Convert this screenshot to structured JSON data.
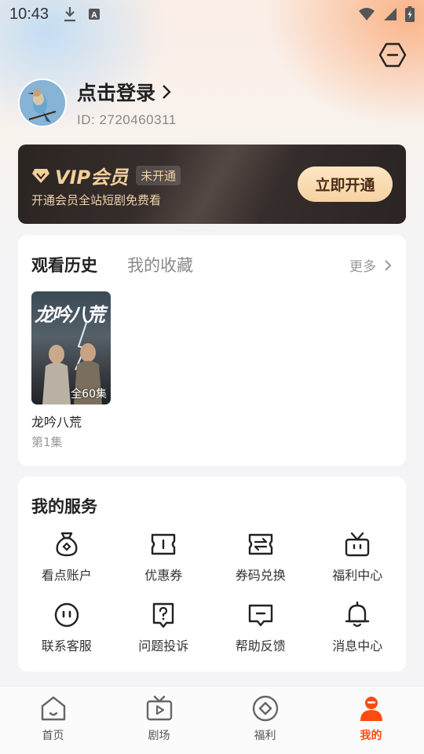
{
  "status_bar": {
    "time": "10:43"
  },
  "profile": {
    "login_text": "点击登录",
    "user_id": "ID: 2720460311"
  },
  "vip": {
    "title": "VIP会员",
    "badge": "未开通",
    "description": "开通会员全站短剧免费看",
    "button": "立即开通"
  },
  "history": {
    "tabs": [
      "观看历史",
      "我的收藏"
    ],
    "more": "更多",
    "items": [
      {
        "poster_title": "龙吟八荒",
        "episode_count": "全60集",
        "name": "龙吟八荒",
        "episode": "第1集"
      }
    ]
  },
  "services": {
    "title": "我的服务",
    "items": [
      {
        "label": "看点账户",
        "icon": "wallet-icon"
      },
      {
        "label": "优惠券",
        "icon": "coupon-icon"
      },
      {
        "label": "券码兑换",
        "icon": "exchange-icon"
      },
      {
        "label": "福利中心",
        "icon": "gift-icon"
      },
      {
        "label": "联系客服",
        "icon": "chat-icon"
      },
      {
        "label": "问题投诉",
        "icon": "question-icon"
      },
      {
        "label": "帮助反馈",
        "icon": "feedback-icon"
      },
      {
        "label": "消息中心",
        "icon": "bell-icon"
      }
    ]
  },
  "tabbar": {
    "items": [
      {
        "label": "首页",
        "icon": "home-icon"
      },
      {
        "label": "剧场",
        "icon": "tv-icon"
      },
      {
        "label": "福利",
        "icon": "coin-icon"
      },
      {
        "label": "我的",
        "icon": "user-icon"
      }
    ],
    "active_color": "#ff4b12"
  }
}
